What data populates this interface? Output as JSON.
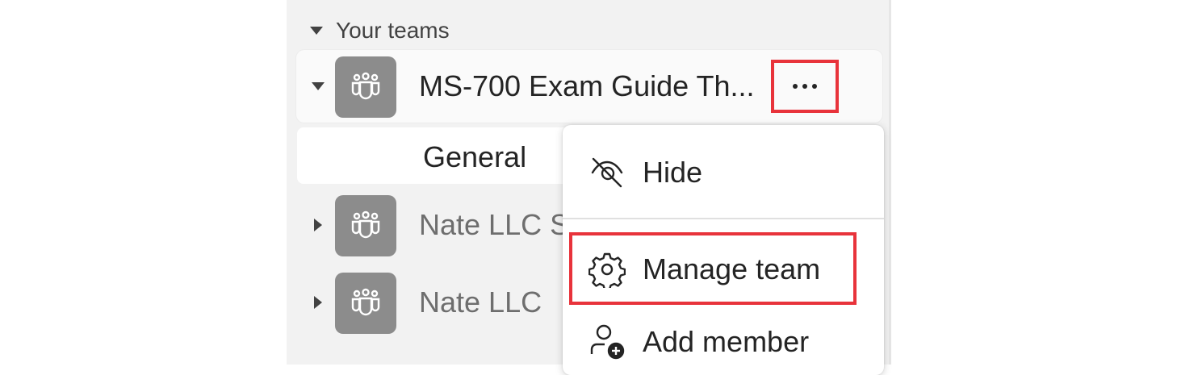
{
  "sidebar": {
    "section_label": "Your teams",
    "teams": [
      {
        "name": "MS-700 Exam Guide Th...",
        "expanded": true,
        "icon": "teams-icon"
      },
      {
        "name": "Nate LLC S",
        "expanded": false,
        "icon": "teams-icon"
      },
      {
        "name": "Nate LLC",
        "expanded": false,
        "icon": "teams-icon"
      }
    ],
    "channels": [
      {
        "name": "General"
      }
    ]
  },
  "context_menu": {
    "items": [
      {
        "label": "Hide",
        "icon": "eye-off-icon"
      },
      {
        "label": "Manage team",
        "icon": "gear-icon"
      },
      {
        "label": "Add member",
        "icon": "add-person-icon"
      }
    ]
  },
  "colors": {
    "highlight": "#e8333b",
    "team_tile": "#8c8c8c",
    "panel_background": "#f2f2f2"
  }
}
